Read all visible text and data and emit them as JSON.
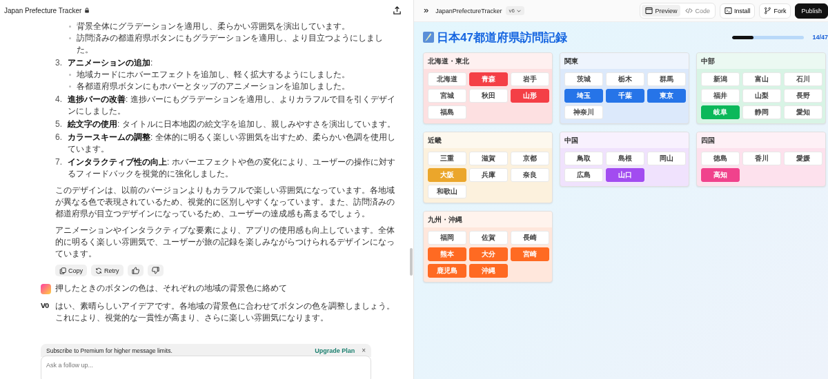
{
  "chat": {
    "title": "Japan Prefecture Tracker",
    "top_bullets": [
      "背景全体にグラデーションを適用し、柔らかい雰囲気を演出しています。",
      "訪問済みの都道府県ボタンにもグラデーションを適用し、より目立つようにしました。"
    ],
    "items": [
      {
        "number": "3.",
        "text": "**アニメーションの追加**:",
        "children": [
          "地域カードにホバーエフェクトを追加し、軽く拡大するようにしました。",
          "各都道府県ボタンにもホバーとタップのアニメーションを追加しました。"
        ]
      },
      {
        "number": "4.",
        "text": "**進捗バーの改善**: 進捗バーにもグラデーションを適用し、よりカラフルで目を引くデザインにしました。"
      },
      {
        "number": "5.",
        "text": "**絵文字の使用**: タイトルに日本地図の絵文字を追加し、親しみやすさを演出しています。"
      },
      {
        "number": "6.",
        "text": "**カラースキームの調整**: 全体的に明るく楽しい雰囲気を出すため、柔らかい色調を使用しています。"
      },
      {
        "number": "7.",
        "text": "**インタラクティブ性の向上**: ホバーエフェクトや色の変化により、ユーザーの操作に対するフィードバックを視覚的に強化しました。"
      }
    ],
    "paragraphs": [
      "このデザインは、以前のバージョンよりもカラフルで楽しい雰囲気になっています。各地域が異なる色で表現されているため、視覚的に区別しやすくなっています。また、訪問済みの都道府県が目立つデザインになっているため、ユーザーの達成感も高まるでしょう。",
      "アニメーションやインタラクティブな要素により、アプリの使用感も向上しています。全体的に明るく楽しい雰囲気で、ユーザーが旅の記録を楽しみながらつけられるデザインになっています。"
    ],
    "actions": [
      {
        "kind": "copy",
        "label": "Copy"
      },
      {
        "kind": "retry",
        "label": "Retry"
      },
      {
        "kind": "like"
      },
      {
        "kind": "dislike"
      }
    ],
    "user_message": "押したときのボタンの色は、それぞれの地域の背景色に絡めて",
    "assistant_logo": "V0",
    "assistant_message": "はい、素晴らしいアイデアです。各地域の背景色に合わせてボタンの色を調整しましょう。これにより、視覚的な一貫性が高まり、さらに楽しい雰囲気になります。",
    "banner": {
      "text": "Subscribe to Premium for higher message limits.",
      "link": "Upgrade Plan",
      "close": "×"
    },
    "input": {
      "placeholder": "Ask a follow up..."
    }
  },
  "preview": {
    "toolbar": {
      "expand": "»",
      "title": "JapanPrefectureTracker",
      "version": "v6",
      "tabs": [
        {
          "label": "Preview",
          "kind": "preview",
          "selected": true
        },
        {
          "label": "Code",
          "kind": "code",
          "selected": false
        }
      ],
      "buttons": [
        {
          "label": "Install",
          "kind": "install"
        },
        {
          "label": "Fork",
          "kind": "fork"
        },
        {
          "label": "Publish",
          "kind": "publish"
        }
      ]
    },
    "title": "日本47都道府県訪問記録",
    "progress": {
      "level": 0.298,
      "reading": "14/47"
    },
    "regions": [
      {
        "name": "北海道・東北",
        "color": "#f43f46",
        "prefectures": [
          {
            "name": "北海道",
            "visited": false
          },
          {
            "name": "青森",
            "visited": true
          },
          {
            "name": "岩手",
            "visited": false
          },
          {
            "name": "宮城",
            "visited": false
          },
          {
            "name": "秋田",
            "visited": false
          },
          {
            "name": "山形",
            "visited": true
          },
          {
            "name": "福島",
            "visited": false
          }
        ]
      },
      {
        "name": "関東",
        "color": "#2674e8",
        "prefectures": [
          {
            "name": "茨城",
            "visited": false
          },
          {
            "name": "栃木",
            "visited": false
          },
          {
            "name": "群馬",
            "visited": false
          },
          {
            "name": "埼玉",
            "visited": true
          },
          {
            "name": "千葉",
            "visited": true
          },
          {
            "name": "東京",
            "visited": true
          },
          {
            "name": "神奈川",
            "visited": false
          }
        ]
      },
      {
        "name": "中部",
        "color": "#0bb85a",
        "prefectures": [
          {
            "name": "新潟",
            "visited": false
          },
          {
            "name": "富山",
            "visited": false
          },
          {
            "name": "石川",
            "visited": false
          },
          {
            "name": "福井",
            "visited": false
          },
          {
            "name": "山梨",
            "visited": false
          },
          {
            "name": "長野",
            "visited": false
          },
          {
            "name": "岐阜",
            "visited": true
          },
          {
            "name": "静岡",
            "visited": false
          },
          {
            "name": "愛知",
            "visited": false
          }
        ]
      },
      {
        "name": "近畿",
        "color": "#eba62b",
        "prefectures": [
          {
            "name": "三重",
            "visited": false
          },
          {
            "name": "滋賀",
            "visited": false
          },
          {
            "name": "京都",
            "visited": false
          },
          {
            "name": "大阪",
            "visited": true
          },
          {
            "name": "兵庫",
            "visited": false
          },
          {
            "name": "奈良",
            "visited": false
          },
          {
            "name": "和歌山",
            "visited": false
          }
        ]
      },
      {
        "name": "中国",
        "color": "#a24cf0",
        "prefectures": [
          {
            "name": "鳥取",
            "visited": false
          },
          {
            "name": "島根",
            "visited": false
          },
          {
            "name": "岡山",
            "visited": false
          },
          {
            "name": "広島",
            "visited": false
          },
          {
            "name": "山口",
            "visited": true
          }
        ]
      },
      {
        "name": "四国",
        "color": "#f0428c",
        "prefectures": [
          {
            "name": "徳島",
            "visited": false
          },
          {
            "name": "香川",
            "visited": false
          },
          {
            "name": "愛媛",
            "visited": false
          },
          {
            "name": "高知",
            "visited": true
          }
        ]
      },
      {
        "name": "九州・沖縄",
        "color": "#ff6a22",
        "prefectures": [
          {
            "name": "福岡",
            "visited": false
          },
          {
            "name": "佐賀",
            "visited": false
          },
          {
            "name": "長崎",
            "visited": false
          },
          {
            "name": "熊本",
            "visited": true
          },
          {
            "name": "大分",
            "visited": true
          },
          {
            "name": "宮崎",
            "visited": true
          },
          {
            "name": "鹿児島",
            "visited": true
          },
          {
            "name": "沖縄",
            "visited": true
          }
        ]
      }
    ]
  }
}
